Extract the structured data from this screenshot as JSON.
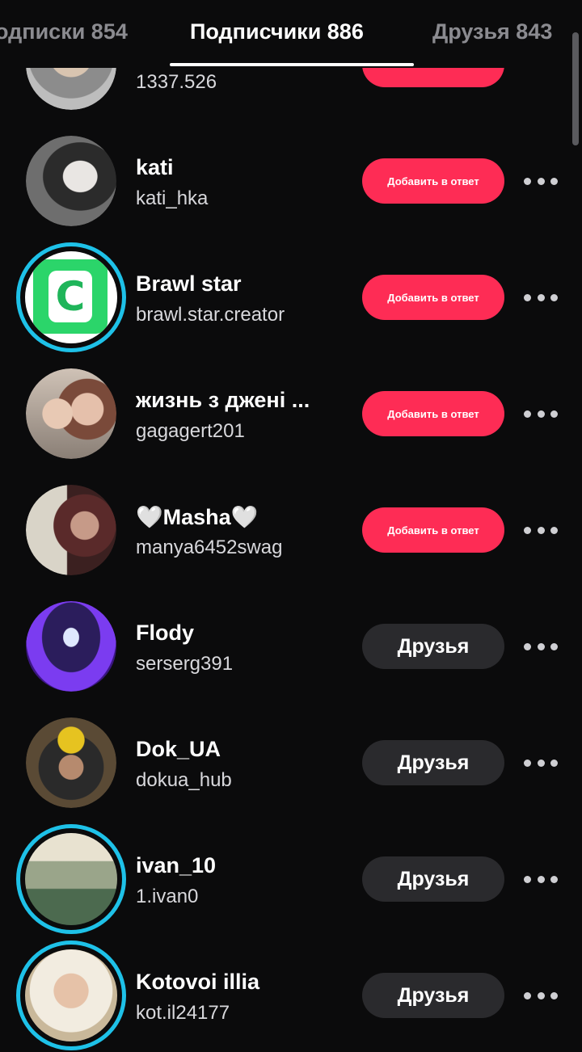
{
  "tabs": [
    {
      "label": "одписки 854"
    },
    {
      "label": "Подписчики 886"
    },
    {
      "label": "Друзья 843"
    }
  ],
  "users": [
    {
      "name": "",
      "handle": "1337.526",
      "button": "",
      "type": "reply"
    },
    {
      "name": "kati",
      "handle": "kati_hka",
      "button": "Добавить в ответ",
      "type": "reply"
    },
    {
      "name": "Brawl star",
      "handle": "brawl.star.creator",
      "button": "Добавить в ответ",
      "type": "reply"
    },
    {
      "name": "жизнь з джені ...",
      "handle": "gagagert201",
      "button": "Добавить в ответ",
      "type": "reply"
    },
    {
      "name": "🤍Masha🤍",
      "handle": "manya6452swag",
      "button": "Добавить в ответ",
      "type": "reply"
    },
    {
      "name": "Flody",
      "handle": "serserg391",
      "button": "Друзья",
      "type": "friends"
    },
    {
      "name": "Dok_UA",
      "handle": "dokua_hub",
      "button": "Друзья",
      "type": "friends"
    },
    {
      "name": "ivan_10",
      "handle": "1.ivan0",
      "button": "Друзья",
      "type": "friends"
    },
    {
      "name": "Kotovoi illia",
      "handle": "kot.il24177",
      "button": "Друзья",
      "type": "friends"
    }
  ],
  "colors": {
    "accent": "#fe2c55",
    "ring": "#1ec1e8",
    "background": "#0b0b0c"
  }
}
